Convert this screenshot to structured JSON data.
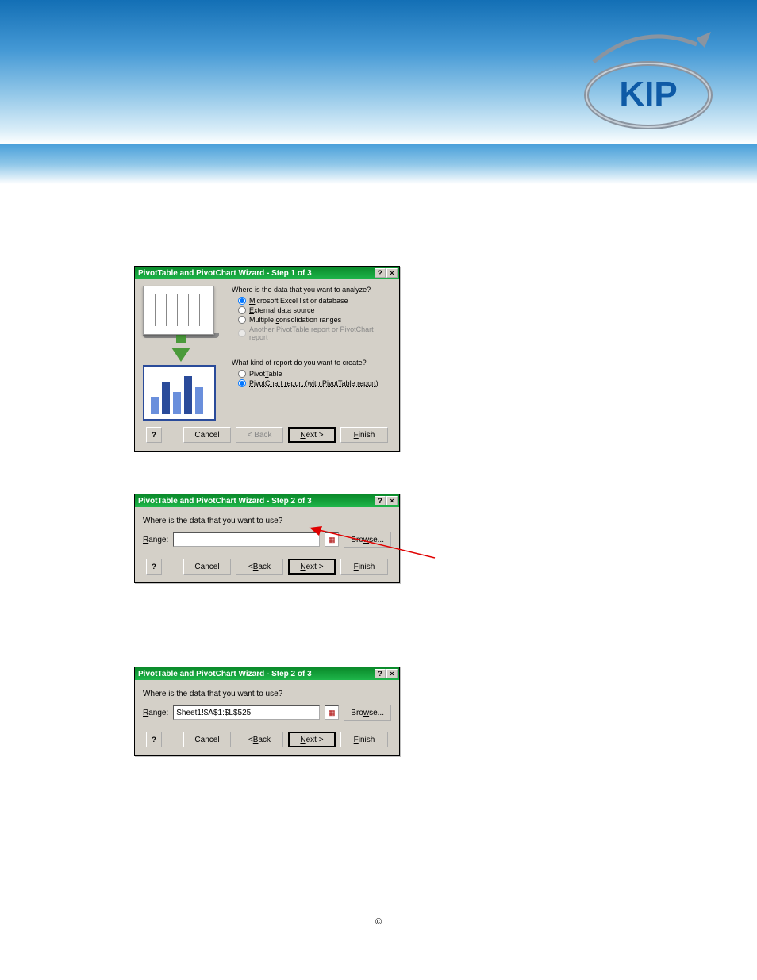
{
  "header": {
    "logo_text": "KIP"
  },
  "dialog1": {
    "title": "PivotTable and PivotChart Wizard - Step 1 of 3",
    "q1": "Where is the data that you want to analyze?",
    "opts1": {
      "a": "Microsoft Excel list or database",
      "b": "External data source",
      "c": "Multiple consolidation ranges",
      "d": "Another PivotTable report or PivotChart report"
    },
    "q2": "What kind of report do you want to create?",
    "opts2": {
      "a": "PivotTable",
      "b": "PivotChart report (with PivotTable report)"
    },
    "buttons": {
      "cancel": "Cancel",
      "back": "< Back",
      "next": "Next >",
      "finish": "Finish"
    }
  },
  "dialog2": {
    "title": "PivotTable and PivotChart Wizard - Step 2 of 3",
    "prompt": "Where is the data that you want to use?",
    "range_label": "Range:",
    "range_value": "",
    "browse": "Browse...",
    "buttons": {
      "cancel": "Cancel",
      "back": "< Back",
      "next": "Next >",
      "finish": "Finish"
    }
  },
  "dialog3": {
    "title": "PivotTable and PivotChart Wizard - Step 2 of 3",
    "prompt": "Where is the data that you want to use?",
    "range_label": "Range:",
    "range_value": "Sheet1!$A$1:$L$525",
    "browse": "Browse...",
    "buttons": {
      "cancel": "Cancel",
      "back": "< Back",
      "next": "Next >",
      "finish": "Finish"
    }
  },
  "footer": {
    "copyright": "©"
  }
}
